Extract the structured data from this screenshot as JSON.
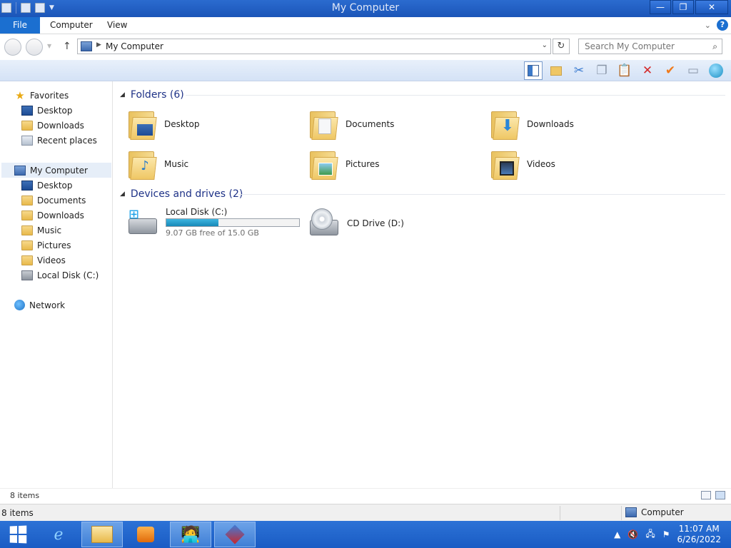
{
  "window": {
    "title": "My Computer"
  },
  "ribbon": {
    "tabs": [
      "File",
      "Computer",
      "View"
    ]
  },
  "address": {
    "path": "My Computer",
    "search_placeholder": "Search My Computer"
  },
  "nav": {
    "favorites": "Favorites",
    "fav_items": [
      "Desktop",
      "Downloads",
      "Recent places"
    ],
    "computer": "My Computer",
    "computer_items": [
      "Desktop",
      "Documents",
      "Downloads",
      "Music",
      "Pictures",
      "Videos",
      "Local Disk (C:)"
    ],
    "network": "Network"
  },
  "content": {
    "folders_header": "Folders (6)",
    "folders": [
      "Desktop",
      "Documents",
      "Downloads",
      "Music",
      "Pictures",
      "Videos"
    ],
    "drives_header": "Devices and drives (2)",
    "drives": [
      {
        "name": "Local Disk (C:)",
        "free_text": "9.07 GB free of 15.0 GB",
        "used_fraction": 0.395
      },
      {
        "name": "CD Drive (D:)"
      }
    ]
  },
  "status": {
    "items": "8 items",
    "outer_items": "8 items",
    "zone": "Computer"
  },
  "taskbar": {
    "time": "11:07 AM",
    "date": "6/26/2022"
  },
  "colors": {
    "accent": "#1b6fd0",
    "header_text": "#1e3287",
    "taskbar": "#1a5cc4"
  }
}
